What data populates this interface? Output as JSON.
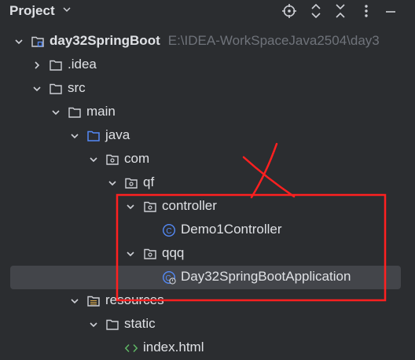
{
  "header": {
    "title": "Project",
    "icons": [
      "chevron-down-icon",
      "locate-target-icon",
      "expand-all-icon",
      "collapse-all-icon",
      "more-options-icon"
    ]
  },
  "tree": {
    "root": {
      "label": "day32SpringBoot",
      "path": "E:\\IDEA-WorkSpaceJava2504\\day3"
    },
    "idea": {
      "label": ".idea"
    },
    "src": {
      "label": "src"
    },
    "main": {
      "label": "main"
    },
    "java": {
      "label": "java"
    },
    "com": {
      "label": "com"
    },
    "qf": {
      "label": "qf"
    },
    "controller": {
      "label": "controller"
    },
    "demo1": {
      "label": "Demo1Controller"
    },
    "qqq": {
      "label": "qqq"
    },
    "app": {
      "label": "Day32SpringBootApplication"
    },
    "resources": {
      "label": "resources"
    },
    "static": {
      "label": "static"
    },
    "index": {
      "label": "index.html"
    }
  },
  "colors": {
    "background": "#2b2d30",
    "selection": "#43454a",
    "text": "#dfe1e5",
    "muted": "#6f737a",
    "annotation": "#ff2020",
    "class_icon": "#548af7"
  }
}
